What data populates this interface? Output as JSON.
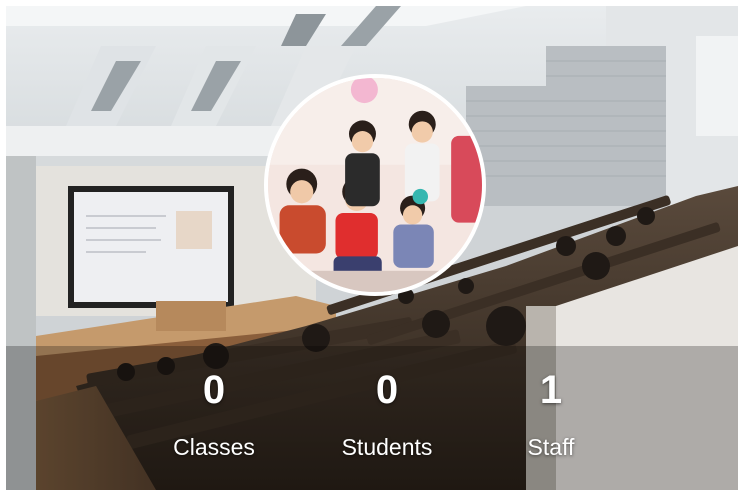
{
  "profile": {
    "cover_image": "lecture-hall-photo",
    "avatar_image": "children-group-photo"
  },
  "stats": [
    {
      "value": "0",
      "label": "Classes"
    },
    {
      "value": "0",
      "label": "Students"
    },
    {
      "value": "1",
      "label": "Staff"
    }
  ],
  "colors": {
    "stat_text": "#ffffff",
    "avatar_border": "#ffffff"
  }
}
